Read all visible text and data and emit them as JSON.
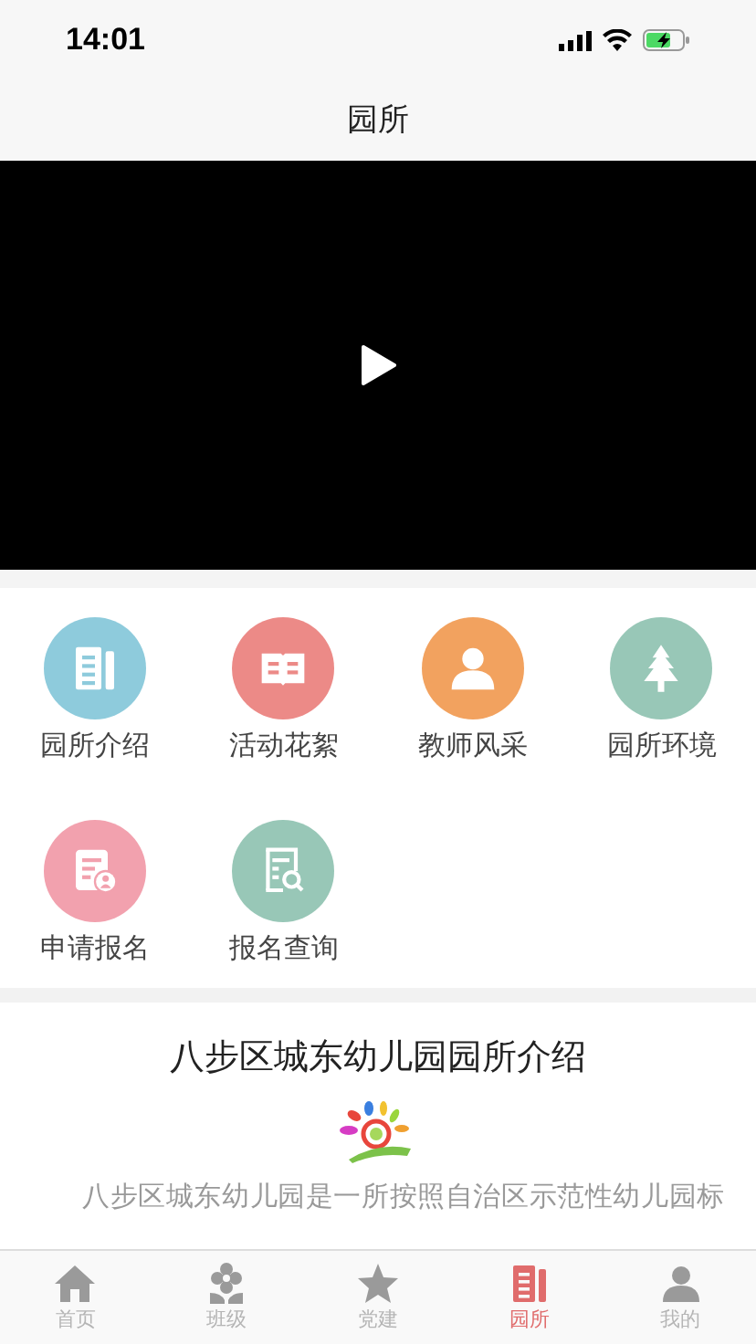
{
  "status_bar": {
    "time": "14:01"
  },
  "nav": {
    "title": "园所"
  },
  "video": {
    "kind": "video"
  },
  "menu": [
    {
      "label": "园所介绍",
      "color": "#8ecbdc"
    },
    {
      "label": "活动花絮",
      "color": "#ec8a87"
    },
    {
      "label": "教师风采",
      "color": "#f2a25f"
    },
    {
      "label": "园所环境",
      "color": "#98c7b7"
    },
    {
      "label": "申请报名",
      "color": "#f2a1ae"
    },
    {
      "label": "报名查询",
      "color": "#98c7b7"
    }
  ],
  "article": {
    "title": "八步区城东幼儿园园所介绍",
    "body": "八步区城东幼儿园是一所按照自治区示范性幼儿园标"
  },
  "tabs": [
    {
      "label": "首页",
      "selected": false
    },
    {
      "label": "班级",
      "selected": false
    },
    {
      "label": "党建",
      "selected": false
    },
    {
      "label": "园所",
      "selected": true
    },
    {
      "label": "我的",
      "selected": false
    }
  ]
}
